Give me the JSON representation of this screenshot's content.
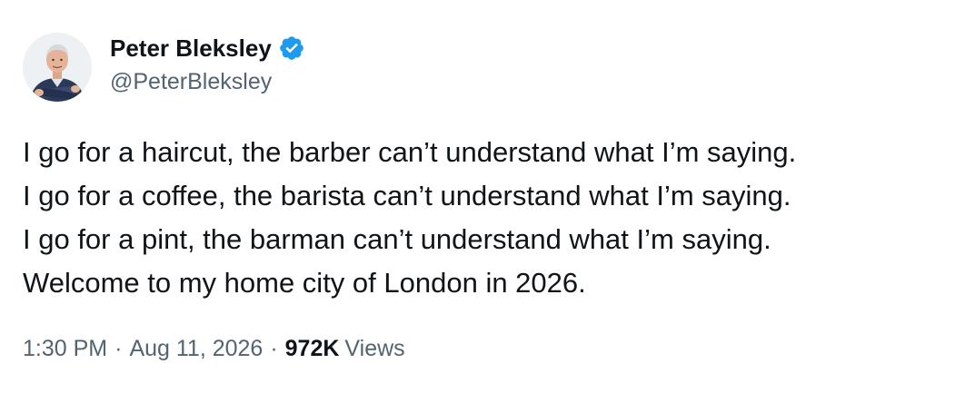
{
  "author": {
    "display_name": "Peter Bleksley",
    "handle": "@PeterBleksley",
    "verified_icon": "verified-badge-icon",
    "verified_color": "#1d9bf0"
  },
  "tweet": {
    "lines": [
      "I go for a haircut, the barber can’t understand what I’m saying.",
      "I go for a coffee, the barista can’t understand what I’m saying.",
      "I go for a pint, the barman can’t understand what I’m saying.",
      "Welcome to my home city of London in 2026."
    ]
  },
  "meta": {
    "time": "1:30 PM",
    "separator": "·",
    "date": "Aug 11, 2026",
    "views_count": "972K",
    "views_label": "Views"
  },
  "colors": {
    "text_primary": "#0f1419",
    "text_secondary": "#536471",
    "background": "#ffffff"
  }
}
